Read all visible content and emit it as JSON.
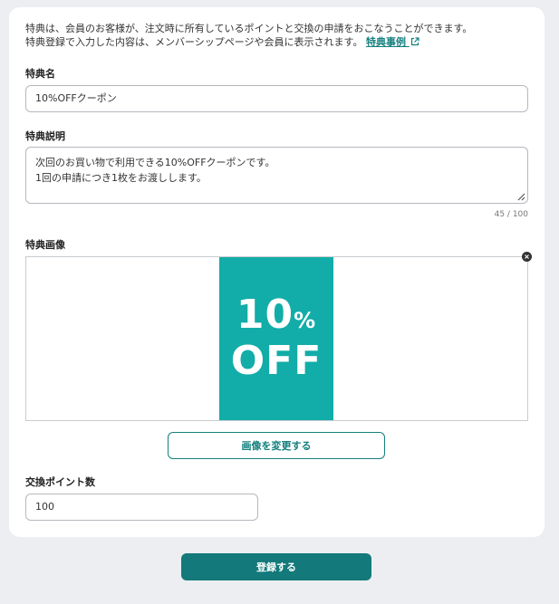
{
  "intro": {
    "line1": "特典は、会員のお客様が、注文時に所有しているポイントと交換の申請をおこなうことができます。",
    "line2": "特典登録で入力した内容は、メンバーシップページや会員に表示されます。",
    "link": "特典事例"
  },
  "name_field": {
    "label": "特典名",
    "value": "10%OFFクーポン"
  },
  "description_field": {
    "label": "特典説明",
    "lines": [
      "次回のお買い物で利用できる10%OFFクーポンです。",
      "1回の申請につき1枚をお渡しします。"
    ],
    "counter": "45 / 100"
  },
  "image_field": {
    "label": "特典画像",
    "coupon_percent": "10",
    "coupon_percent_sign": "%",
    "coupon_off": "OFF",
    "coupon_color": "#12ada8",
    "change_button": "画像を変更する"
  },
  "points_field": {
    "label": "交換ポイント数",
    "value": "100"
  },
  "submit_button": "登録する",
  "colors": {
    "accent": "#13807e",
    "background": "#eceef1"
  }
}
